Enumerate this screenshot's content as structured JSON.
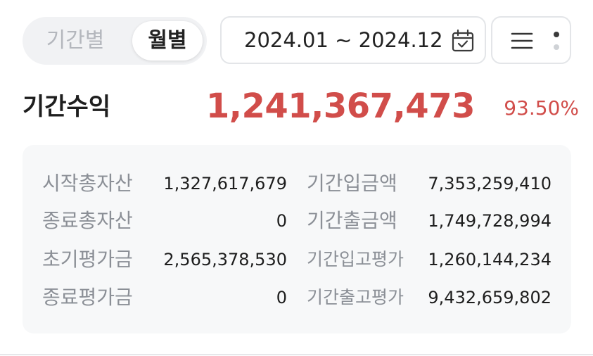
{
  "toggle": {
    "options": [
      "기간별",
      "월별"
    ],
    "selected": "월별"
  },
  "date_range": {
    "label": "2024.01 ~ 2024.12",
    "icon": "calendar-check-icon"
  },
  "menu": {
    "icon": "hamburger-menu-icon"
  },
  "summary": {
    "label": "기간수익",
    "value": "1,241,367,473",
    "rate": "93.50%",
    "color": "#d14d4a"
  },
  "details": {
    "rows": [
      {
        "left_label": "시작총자산",
        "left_value": "1,327,617,679",
        "right_label": "기간입금액",
        "right_value": "7,353,259,410"
      },
      {
        "left_label": "종료총자산",
        "left_value": "0",
        "right_label": "기간출금액",
        "right_value": "1,749,728,994"
      },
      {
        "left_label": "초기평가금",
        "left_value": "2,565,378,530",
        "right_label": "기간입고평가",
        "right_value": "1,260,144,234"
      },
      {
        "left_label": "종료평가금",
        "left_value": "0",
        "right_label": "기간출고평가",
        "right_value": "9,432,659,802"
      }
    ]
  }
}
